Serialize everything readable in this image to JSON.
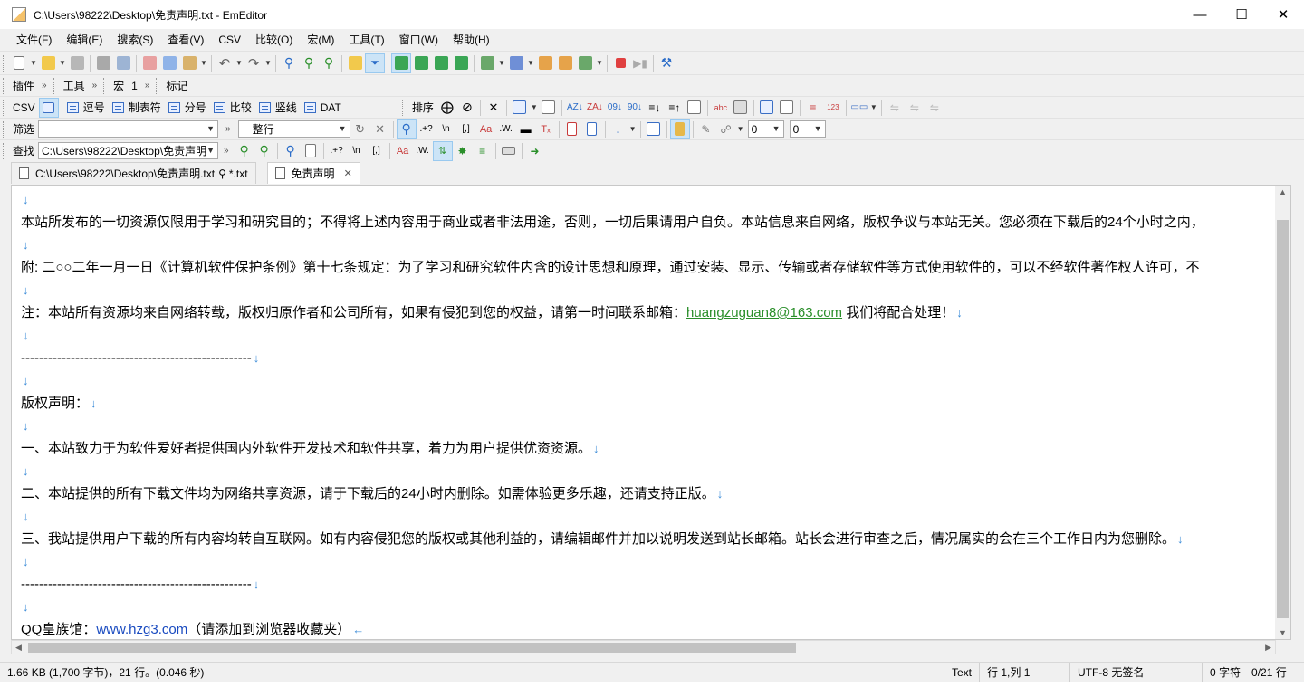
{
  "window": {
    "title": "C:\\Users\\98222\\Desktop\\免责声明.txt - EmEditor"
  },
  "menu": [
    "文件(F)",
    "编辑(E)",
    "搜索(S)",
    "查看(V)",
    "CSV",
    "比较(O)",
    "宏(M)",
    "工具(T)",
    "窗口(W)",
    "帮助(H)"
  ],
  "toolbar_row2": {
    "plugins": "插件",
    "tools": "工具",
    "macro": "宏",
    "macro_extra": "1",
    "marks": "标记"
  },
  "toolbar_row3": {
    "csv": "CSV",
    "comma": "逗号",
    "tab": "制表符",
    "semicolon": "分号",
    "compare": "比较",
    "vertical": "竖线",
    "dat": "DAT",
    "sort": "排序"
  },
  "filter_bar": {
    "label": "筛选",
    "input_value": "",
    "mode_value": "一整行",
    "num1": "0",
    "num2": "0"
  },
  "find_bar": {
    "label": "查找",
    "input_value": "C:\\Users\\98222\\Desktop\\免责声明"
  },
  "tabs": [
    {
      "label": "C:\\Users\\98222\\Desktop\\免责声明.txt",
      "extra": "*.txt"
    },
    {
      "label": "免责声明"
    }
  ],
  "document": {
    "lines": [
      "",
      "本站所发布的一切资源仅限用于学习和研究目的；不得将上述内容用于商业或者非法用途，否则，一切后果请用户自负。本站信息来自网络，版权争议与本站无关。您必须在下载后的24个小时之内，",
      "",
      "附: 二○○二年一月一日《计算机软件保护条例》第十七条规定：为了学习和研究软件内含的设计思想和原理，通过安装、显示、传输或者存储软件等方式使用软件的，可以不经软件著作权人许可，不",
      "",
      "注：本站所有资源均来自网络转载，版权归原作者和公司所有，如果有侵犯到您的权益，请第一时间联系邮箱：",
      "",
      "---------------------------------------------------",
      "",
      "版权声明：",
      "",
      "一、本站致力于为软件爱好者提供国内外软件开发技术和软件共享，着力为用户提供优资资源。",
      "",
      "二、本站提供的所有下载文件均为网络共享资源，请于下载后的24小时内删除。如需体验更多乐趣，还请支持正版。",
      "",
      "三、我站提供用户下载的所有内容均转自互联网。如有内容侵犯您的版权或其他利益的，请编辑邮件并加以说明发送到站长邮箱。站长会进行审查之后，情况属实的会在三个工作日内为您删除。",
      "",
      "---------------------------------------------------",
      "",
      "QQ皇族馆："
    ],
    "email": "huangzuguan8@163.com",
    "email_suffix": " 我们将配合处理！",
    "url": "www.hzg3.com",
    "url_suffix": "（请添加到浏览器收藏夹）",
    "newline_glyph": "↓",
    "eof_glyph": "←"
  },
  "status": {
    "size": "1.66 KB (1,700 字节)，21 行。(0.046 秒)",
    "mode": "Text",
    "position": "行 1,列 1",
    "encoding": "UTF-8 无签名",
    "chars": "0 字符",
    "line_count": "0/21 行"
  },
  "colors": {
    "newline": "#3c8cd8",
    "email": "#2a8f2a",
    "url": "#1a4bc0"
  }
}
